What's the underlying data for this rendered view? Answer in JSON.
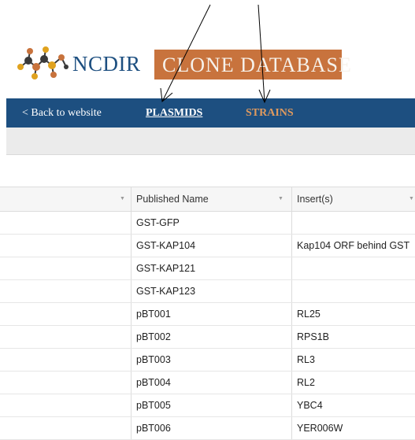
{
  "brand": {
    "name_left": "NCDIR",
    "name_right": "CLONE DATABASE",
    "accent": "#c8733d",
    "navy": "#1d4f80"
  },
  "nav": {
    "back": "< Back to website",
    "plasmids": "PLASMIDS",
    "strains": "STRAINS"
  },
  "table": {
    "columns": [
      "",
      "Published Name",
      "Insert(s)"
    ],
    "rows": [
      {
        "name": "GST-GFP",
        "insert": ""
      },
      {
        "name": "GST-KAP104",
        "insert": "Kap104 ORF behind GST"
      },
      {
        "name": "GST-KAP121",
        "insert": ""
      },
      {
        "name": "GST-KAP123",
        "insert": ""
      },
      {
        "name": "pBT001",
        "insert": "RL25"
      },
      {
        "name": "pBT002",
        "insert": "RPS1B"
      },
      {
        "name": "pBT003",
        "insert": "RL3"
      },
      {
        "name": "pBT004",
        "insert": "RL2"
      },
      {
        "name": "pBT005",
        "insert": "YBC4"
      },
      {
        "name": "pBT006",
        "insert": "YER006W"
      }
    ]
  }
}
